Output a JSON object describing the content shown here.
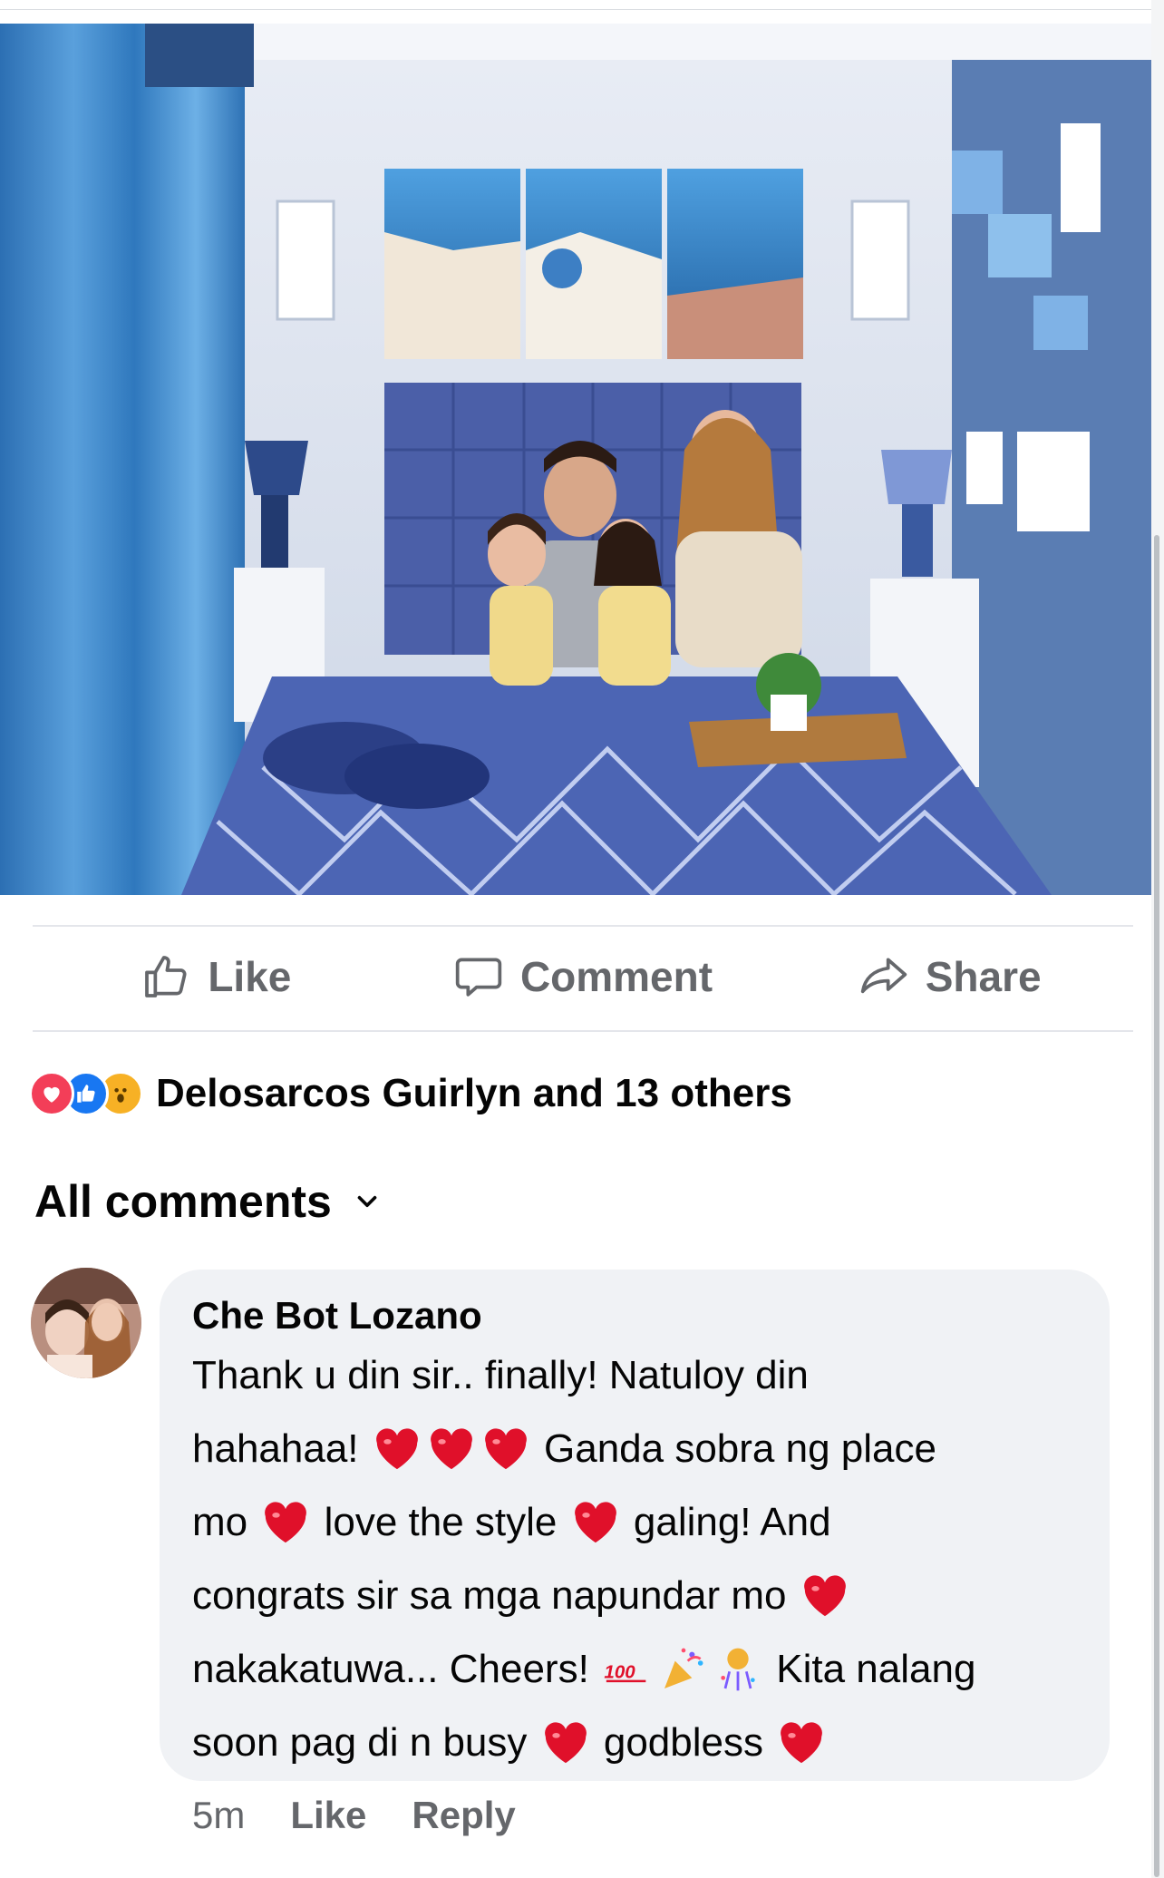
{
  "post": {
    "photo_description_icon": "family-bedroom-photo"
  },
  "actions": {
    "like": "Like",
    "comment": "Comment",
    "share": "Share"
  },
  "reactions": {
    "icons": [
      "love-icon",
      "like-icon",
      "wow-icon"
    ],
    "summary": "Delosarcos Guirlyn and 13 others"
  },
  "comments": {
    "header": "All comments"
  },
  "comment": {
    "author": "Che Bot Lozano",
    "lines": {
      "l1": "Thank u din sir.. finally! Natuloy din",
      "l2a": "hahahaa!",
      "l2b": "Ganda sobra ng place",
      "l3a": "mo",
      "l3b": "love the style",
      "l3c": "galing! And",
      "l4a": "congrats sir sa mga napundar mo",
      "l5a": "nakakatuwa... Cheers!",
      "l5b": "Kita nalang",
      "l6a": "soon pag di n busy",
      "l6b": "godbless"
    },
    "time": "5m",
    "like": "Like",
    "reply": "Reply"
  },
  "colors": {
    "secondary_text": "#65676b",
    "bubble": "#f0f2f5",
    "like_blue": "#1877f2",
    "love_red": "#f33e58",
    "heart_red": "#e0102a"
  }
}
